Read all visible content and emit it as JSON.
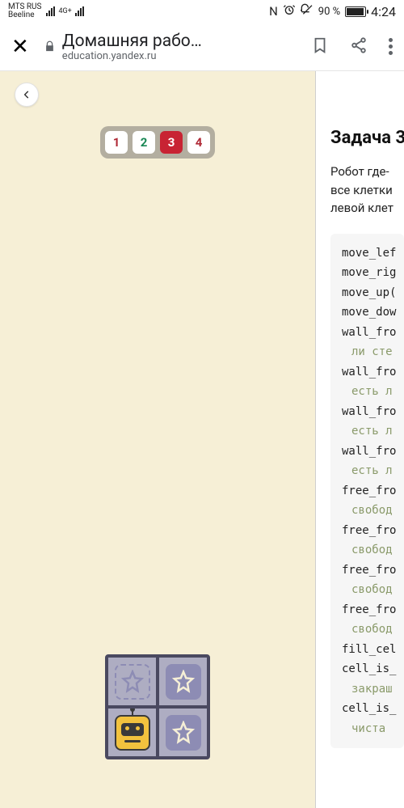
{
  "status": {
    "carrier1": "MTS RUS",
    "carrier2": "Beeline",
    "net_label": "4G+",
    "nfc": "N",
    "battery_pct": "90 %",
    "time": "4:24"
  },
  "chrome": {
    "page_title": "Домашняя рабо…",
    "host": "education.yandex.ru"
  },
  "tabs": {
    "items": [
      "1",
      "2",
      "3",
      "4"
    ],
    "active_index": 2
  },
  "task": {
    "title": "Задача 3",
    "description_line1": "Робот где-",
    "description_line2": "все клетки",
    "description_line3": "левой клет"
  },
  "code": {
    "lines": [
      {
        "t": "move_lef",
        "c": false
      },
      {
        "t": "move_rig",
        "c": false
      },
      {
        "t": "move_up(",
        "c": false
      },
      {
        "t": "move_dow",
        "c": false
      },
      {
        "t": "wall_fro",
        "c": false
      },
      {
        "t": "ли сте",
        "c": true
      },
      {
        "t": "wall_fro",
        "c": false
      },
      {
        "t": "есть л",
        "c": true
      },
      {
        "t": "wall_fro",
        "c": false
      },
      {
        "t": "есть л",
        "c": true
      },
      {
        "t": "wall_fro",
        "c": false
      },
      {
        "t": "есть л",
        "c": true
      },
      {
        "t": "free_fro",
        "c": false
      },
      {
        "t": "свобод",
        "c": true
      },
      {
        "t": "free_fro",
        "c": false
      },
      {
        "t": "свобод",
        "c": true
      },
      {
        "t": "free_fro",
        "c": false
      },
      {
        "t": "свобод",
        "c": true
      },
      {
        "t": "free_fro",
        "c": false
      },
      {
        "t": "свобод",
        "c": true
      },
      {
        "t": "fill_cel",
        "c": false
      },
      {
        "t": "cell_is_",
        "c": false
      },
      {
        "t": "закраш",
        "c": true
      },
      {
        "t": "cell_is_",
        "c": false
      },
      {
        "t": "чиста ",
        "c": true
      }
    ]
  },
  "board": {
    "cells": [
      "star_dashed",
      "star",
      "robot",
      "star"
    ]
  }
}
